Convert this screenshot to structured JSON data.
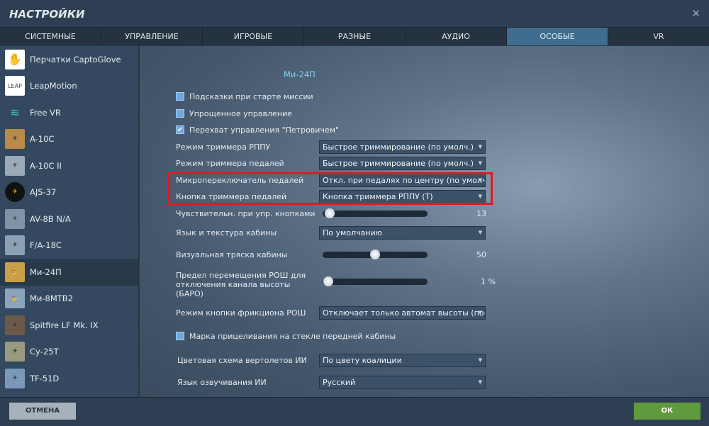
{
  "window": {
    "title": "НАСТРОЙКИ",
    "close": "✕"
  },
  "tabs": [
    "СИСТЕМНЫЕ",
    "УПРАВЛЕНИЕ",
    "ИГРОВЫЕ",
    "РАЗНЫЕ",
    "АУДИО",
    "ОСОБЫЕ",
    "VR"
  ],
  "active_tab": "ОСОБЫЕ",
  "sidebar": {
    "items": [
      "Перчатки CaptoGlove",
      "LeapMotion",
      "Free VR",
      "A-10C",
      "A-10C II",
      "AJS-37",
      "AV-8B N/A",
      "F/A-18C",
      "Ми-24П",
      "Ми-8МТВ2",
      "Spitfire LF Mk. IX",
      "Су-25Т",
      "TF-51D"
    ],
    "selected": "Ми-24П",
    "leap_logo": "LEAP"
  },
  "main": {
    "heading": "Ми-24П",
    "checkboxes": [
      {
        "label": "Подсказки при старте миссии",
        "checked": false
      },
      {
        "label": "Упрощенное управление",
        "checked": false
      },
      {
        "label": "Перехват управления \"Петровичем\"",
        "checked": true
      },
      {
        "label": "Марка прицеливания на стекле передней кабины",
        "checked": false
      }
    ],
    "dropdowns": [
      {
        "label": "Режим триммера РППУ",
        "value": "Быстрое триммирование (по умолч.)"
      },
      {
        "label": "Режим триммера педалей",
        "value": "Быстрое триммирование (по умолч.)"
      },
      {
        "label": "Микропереключатель педалей",
        "value": "Откл. при педалях по центру (по умолч.)"
      },
      {
        "label": "Кнопка триммера педалей",
        "value": "Кнопка триммера РППУ (T)"
      },
      {
        "label": "Язык и текстура кабины",
        "value": "По умолчанию"
      },
      {
        "label": "Режим кнопки фрикциона РОШ",
        "value": "Отключает только автомат высоты (по-умолч"
      },
      {
        "label": "Цветовая схема вертолетов ИИ",
        "value": "По цвету коалиции"
      },
      {
        "label": "Язык озвучивания ИИ",
        "value": "Русский"
      }
    ],
    "sliders": [
      {
        "label": "Чувствительн. при упр. кнопками",
        "value": "13",
        "fraction": 0.02
      },
      {
        "label": "Визуальная тряска кабины",
        "value": "50",
        "fraction": 0.5
      },
      {
        "label": "Предел перемещения РОШ для отключения канала высоты (БАРО)",
        "value": "1 %",
        "fraction": 0.01
      }
    ]
  },
  "footer": {
    "cancel": "ОТМЕНА",
    "ok": "ОК"
  },
  "colors": {
    "accent": "#3f6d8f",
    "heading": "#7fd3f0",
    "highlight": "#e01822",
    "ok": "#5f9a3c"
  }
}
